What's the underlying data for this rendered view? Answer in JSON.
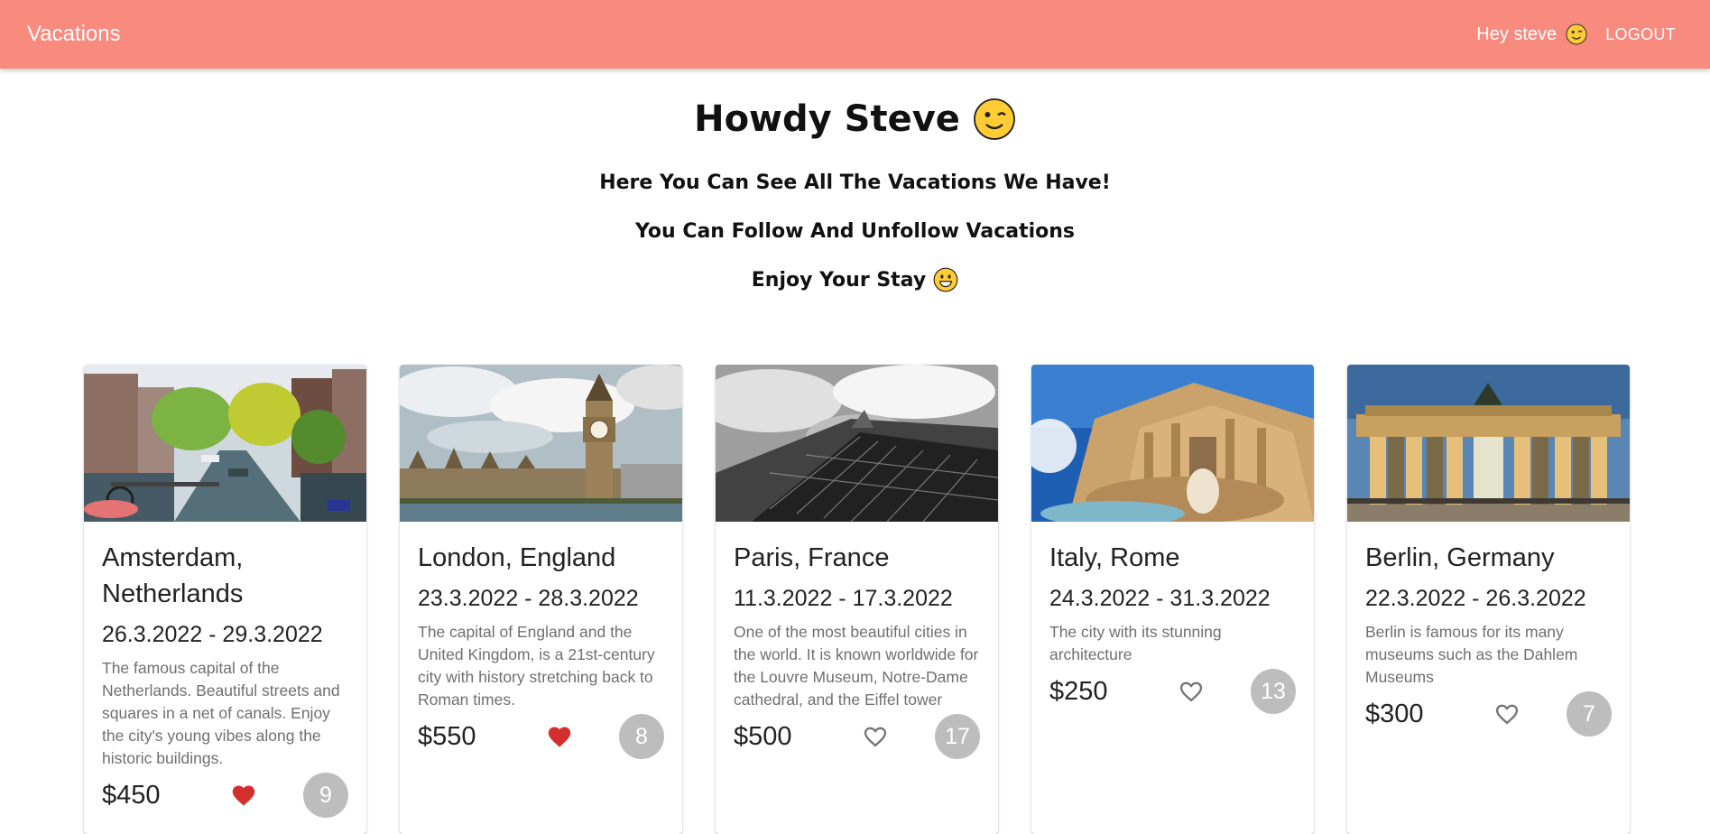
{
  "appbar": {
    "title": "Vacations",
    "greeting": "Hey steve",
    "greeting_icon": "winking-face-icon",
    "logout_label": "LOGOUT",
    "color": "#f88a7e"
  },
  "hero": {
    "heading": "Howdy Steve",
    "heading_icon": "winking-face-icon",
    "line1": "Here You Can See All The Vacations We Have!",
    "line2": "You Can Follow And Unfollow Vacations",
    "line3": "Enjoy Your Stay",
    "line3_icon": "grinning-face-icon"
  },
  "vacations": [
    {
      "destination": "Amsterdam, Netherlands",
      "dates": "26.3.2022 - 29.3.2022",
      "description": "The famous capital of the Netherlands. Beautiful streets and squares in a net of canals. Enjoy the city's young vibes along the historic buildings.",
      "price": "$450",
      "followed": true,
      "followers": "9",
      "image": "canal-photo"
    },
    {
      "destination": "London, England",
      "dates": "23.3.2022 - 28.3.2022",
      "description": "The capital of England and the United Kingdom, is a 21st-century city with history stretching back to Roman times.",
      "price": "$550",
      "followed": true,
      "followers": "8",
      "image": "big-ben-photo"
    },
    {
      "destination": "Paris, France",
      "dates": "11.3.2022 - 17.3.2022",
      "description": "One of the most beautiful cities in the world. It is known worldwide for the Louvre Museum, Notre-Dame cathedral, and the Eiffel tower",
      "price": "$500",
      "followed": false,
      "followers": "17",
      "image": "eiffel-tower-photo"
    },
    {
      "destination": "Italy, Rome",
      "dates": "24.3.2022 - 31.3.2022",
      "description": "The city with its stunning architecture",
      "price": "$250",
      "followed": false,
      "followers": "13",
      "image": "trevi-fountain-photo"
    },
    {
      "destination": "Berlin, Germany",
      "dates": "22.3.2022 - 26.3.2022",
      "description": "Berlin is famous for its many museums such as the Dahlem Museums",
      "price": "$300",
      "followed": false,
      "followers": "7",
      "image": "brandenburg-gate-photo"
    }
  ],
  "colors": {
    "heart_filled": "#d32f2f",
    "heart_outline": "#757575",
    "badge": "#bdbdbd"
  }
}
